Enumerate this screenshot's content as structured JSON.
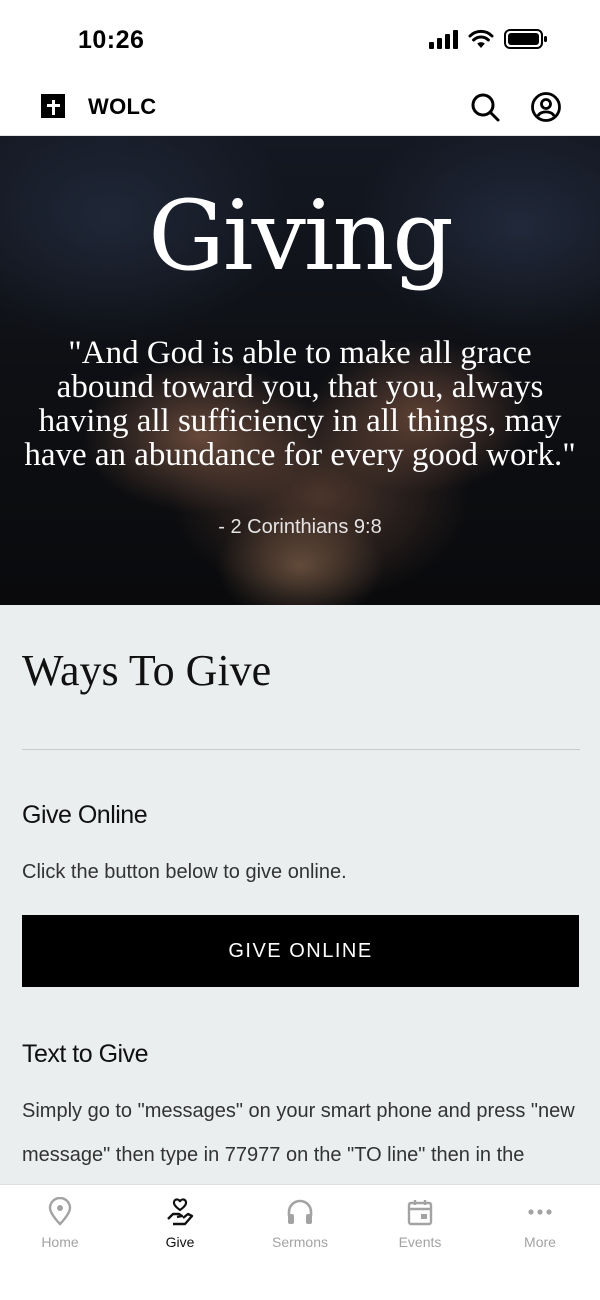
{
  "status_bar": {
    "time": "10:26"
  },
  "header": {
    "app_name": "WOLC"
  },
  "hero": {
    "title": "Giving",
    "quote": "\"And God is able to make all grace abound toward you, that you, always having all sufficiency in all things, may have an abundance for every good work.\"",
    "reference": "- 2 Corinthians 9:8"
  },
  "content": {
    "section_title": "Ways To Give",
    "give_online": {
      "title": "Give Online",
      "text": "Click the button below to give online.",
      "button_label": "GIVE ONLINE"
    },
    "text_to_give": {
      "title": "Text to Give",
      "text": "Simply go to \"messages\" on your smart phone and press \"new message\" then type in 77977 on the \"TO line\" then in the"
    }
  },
  "tab_bar": {
    "items": [
      {
        "label": "Home",
        "icon": "location-pin-icon",
        "active": false
      },
      {
        "label": "Give",
        "icon": "hand-heart-icon",
        "active": true
      },
      {
        "label": "Sermons",
        "icon": "headphones-icon",
        "active": false
      },
      {
        "label": "Events",
        "icon": "calendar-icon",
        "active": false
      },
      {
        "label": "More",
        "icon": "more-dots-icon",
        "active": false
      }
    ]
  },
  "colors": {
    "content_background": "#ebeeef",
    "button_background": "#000000",
    "tab_inactive": "#a3a3a3",
    "tab_active": "#111111"
  }
}
